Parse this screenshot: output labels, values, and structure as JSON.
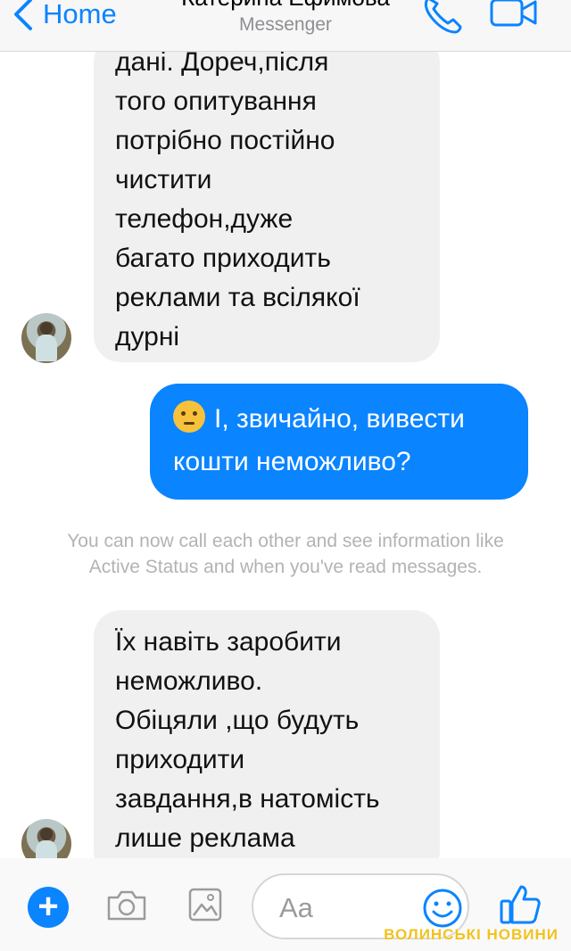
{
  "header": {
    "back_label": "Home",
    "contact_name": "Катерина Ефимова",
    "subtitle": "Messenger"
  },
  "messages": [
    {
      "direction": "incoming",
      "lines": [
        "дані. Дореч,після",
        "того опитування",
        "потрібно постійно",
        "чистити",
        "телефон,дуже",
        "багато приходить",
        "реклами та всілякої",
        "дурні"
      ]
    },
    {
      "direction": "outgoing",
      "emoji": "thinking-face",
      "lines": [
        "І, звичайно, вивести",
        "кошти неможливо?"
      ]
    },
    {
      "direction": "incoming",
      "lines": [
        "Їх навіть заробити",
        "неможливо.",
        "Обіцяли ,що будуть",
        "приходити",
        "завдання,в натомість",
        "лише реклама"
      ]
    }
  ],
  "system_note": {
    "line1": "You can now call each other and see information like",
    "line2": "Active Status and when you've read messages."
  },
  "composer": {
    "placeholder": "Aa"
  },
  "watermark": "ВОЛИНСЬКІ НОВИНИ",
  "colors": {
    "accent": "#0a84ff",
    "incoming_bubble": "#f1f0f0"
  }
}
